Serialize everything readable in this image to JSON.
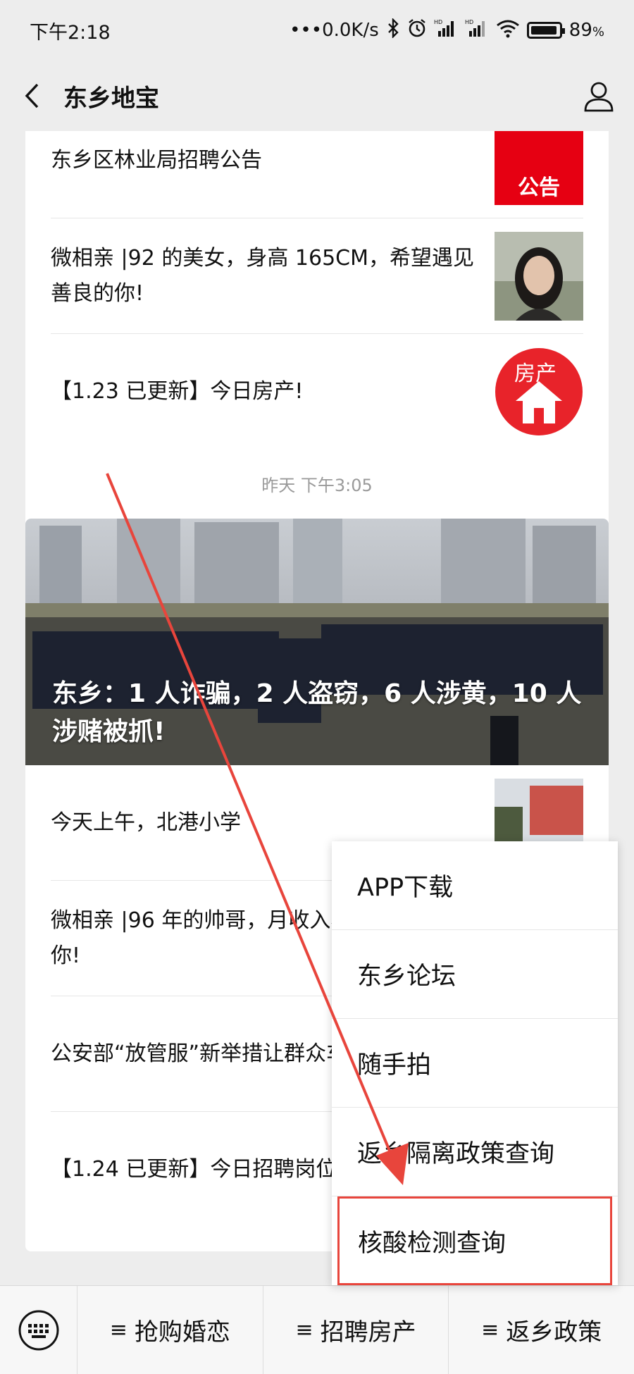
{
  "status_bar": {
    "time": "下午2:18",
    "network_speed": "•••0.0K/s",
    "battery": "89",
    "battery_unit": "%"
  },
  "nav": {
    "title": "东乡地宝"
  },
  "timestamp": "昨天 下午3:05",
  "card1": {
    "items": [
      {
        "text": "东乡区林业局招聘公告",
        "thumb": "red-notice-icon"
      },
      {
        "text": "微相亲 |92 的美女，身高 165CM，希望遇见善良的你!",
        "thumb": "woman-photo"
      },
      {
        "text": "【1.23 已更新】今日房产!",
        "thumb": "house-icon",
        "thumb_label": "房产"
      }
    ]
  },
  "card2": {
    "hero_title": "东乡：1 人诈骗，2 人盗窃，6 人涉黄，10 人涉赌被抓!",
    "items": [
      {
        "text": "今天上午，北港小学",
        "thumb": "school-photo"
      },
      {
        "text": "微相亲 |96 年的帅哥，月收入希望遇见善良的你!"
      },
      {
        "text": "公安部“放管服”新举措让群众车"
      },
      {
        "text": "【1.24 已更新】今日招聘岗位"
      }
    ]
  },
  "popup_menu": {
    "items": [
      {
        "label": "APP下载"
      },
      {
        "label": "东乡论坛"
      },
      {
        "label": "随手拍"
      },
      {
        "label": "返乡隔离政策查询"
      },
      {
        "label": "核酸检测查询",
        "highlighted": true
      }
    ]
  },
  "bottom_menu": {
    "tabs": [
      {
        "label": "抢购婚恋"
      },
      {
        "label": "招聘房产"
      },
      {
        "label": "返乡政策"
      }
    ]
  },
  "colors": {
    "accent_red": "#e8453c",
    "background": "#ededed",
    "notice_red": "#e60012"
  }
}
